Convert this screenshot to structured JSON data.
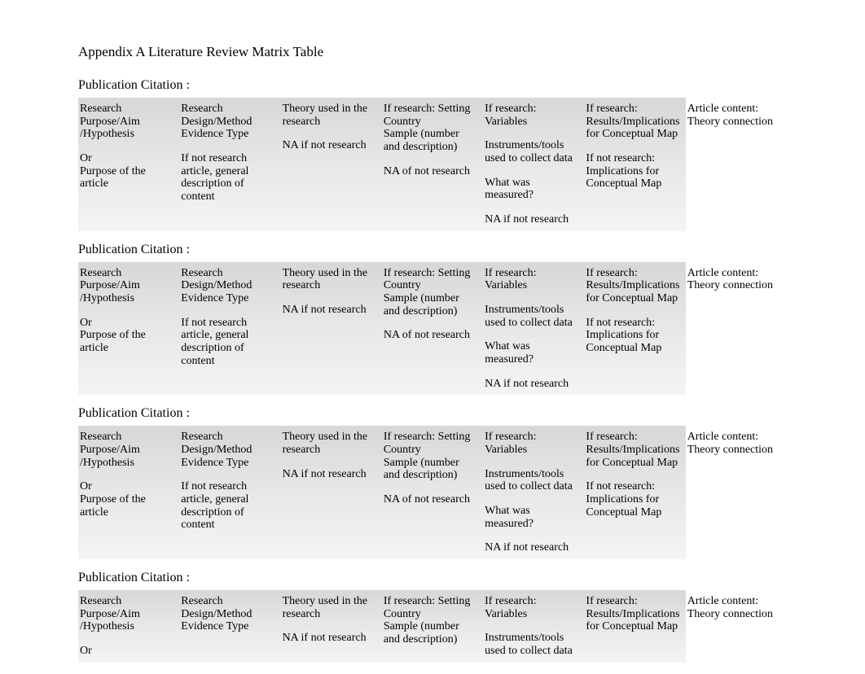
{
  "title": "Appendix A  Literature Review Matrix Table",
  "citation_label": "Publication Citation :",
  "columns": {
    "col1": {
      "p1": "Research Purpose/Aim /Hypothesis",
      "p2": "Or",
      "p3": "Purpose of the article"
    },
    "col2": {
      "p1": "Research Design/Method Evidence Type",
      "p2": "If not research article, general description of content"
    },
    "col3": {
      "p1": "Theory used in the research",
      "p2": "NA if not research"
    },
    "col4": {
      "p1": "If research: Setting Country",
      "p2": "Sample (number and description)",
      "p3": "NA of not research"
    },
    "col5": {
      "p1": "If research: Variables",
      "p2": "Instruments/tools used to collect data",
      "p3": "What was measured?",
      "p4": "NA if not research"
    },
    "col6": {
      "p1": "If research: Results/Implications for Conceptual Map",
      "p2": "If not research: Implications for Conceptual Map"
    },
    "col7": {
      "p1": "Article content: Theory connection"
    }
  }
}
